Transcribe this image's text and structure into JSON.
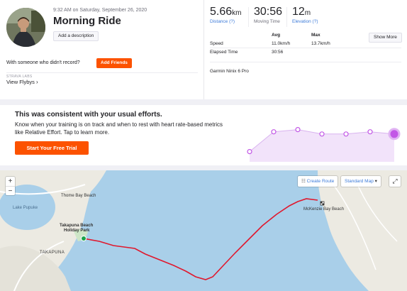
{
  "activity": {
    "datetime": "9:32 AM on Saturday, September 26, 2020",
    "title": "Morning Ride",
    "add_description": "Add a description",
    "friends_prompt": "With someone who didn't record?",
    "add_friends": "Add Friends",
    "labs_label": "STRAVA LABS",
    "view_flybys": "View Flybys"
  },
  "stats": {
    "distance_value": "5.66",
    "distance_unit": "km",
    "distance_label": "Distance (?)",
    "moving_time_value": "30:56",
    "moving_time_label": "Moving Time",
    "elevation_value": "12",
    "elevation_unit": "m",
    "elevation_label": "Elevation (?)",
    "col_avg": "Avg",
    "col_max": "Max",
    "show_more": "Show More",
    "speed_label": "Speed",
    "speed_avg": "11.0km/h",
    "speed_max": "13.7km/h",
    "elapsed_label": "Elapsed Time",
    "elapsed_value": "30:56",
    "device": "Garmin Ninix 6 Pro"
  },
  "efforts": {
    "title": "This was consistent with your usual efforts.",
    "body": "Know when your training is on track and when to rest with heart rate-based metrics like Relative Effort. Tap to learn more.",
    "trial_button": "Start Your Free Trial",
    "trend_values": [
      2,
      6.5,
      7,
      6,
      6,
      6.5,
      6
    ],
    "accent_color": "#c257e6"
  },
  "map": {
    "create_route": "Create Route",
    "standard_map": "Standard Map",
    "zoom_in": "+",
    "zoom_out": "−",
    "labels": {
      "thome_bay": "Thome Bay Beach",
      "lake": "Lake Pupuke",
      "takapuna_beach": "Takapuna Beach",
      "holiday_park": "Holiday Park",
      "takapuna": "TAKAPUNA",
      "mckenzie": "McKenzie Bay Beach"
    },
    "route_color": "#e0182d",
    "water_color": "#a9cfe9",
    "land_color": "#eceae2"
  }
}
